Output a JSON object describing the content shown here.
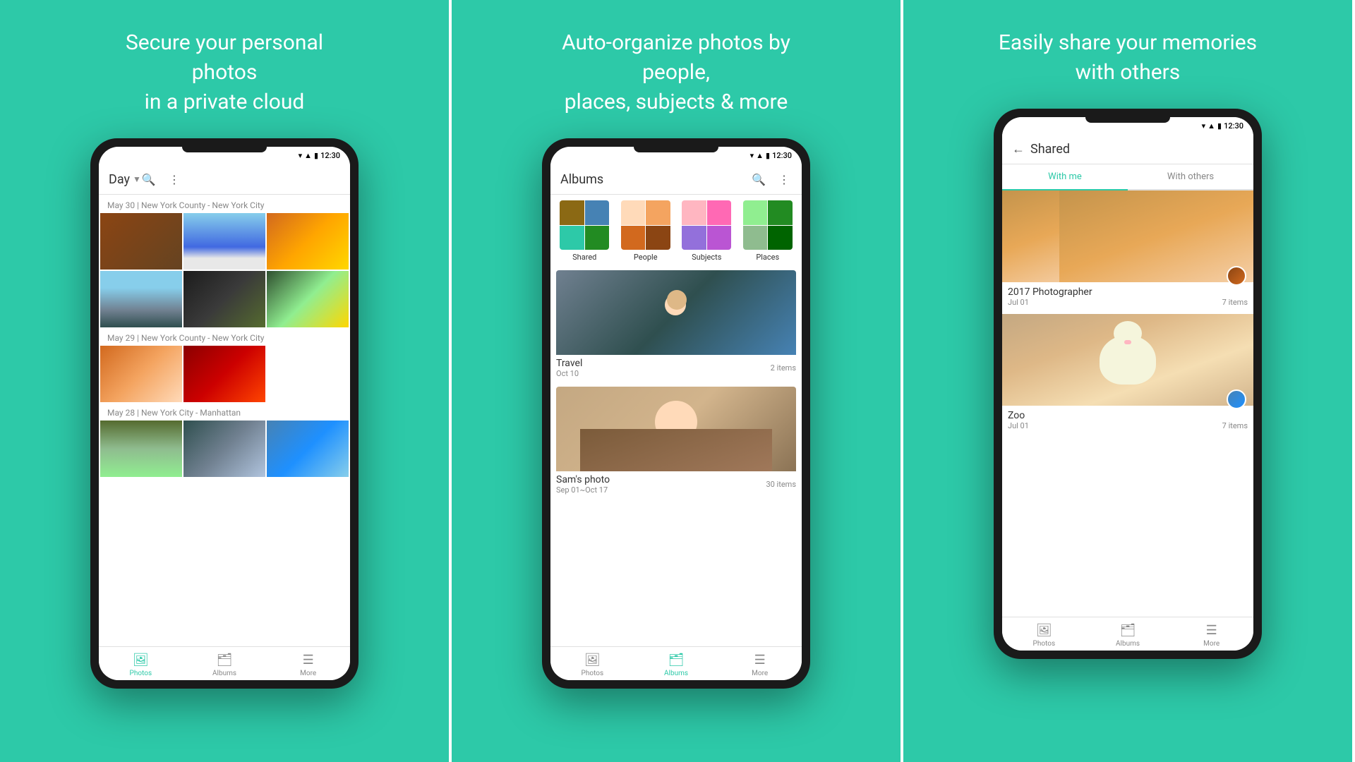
{
  "panel1": {
    "title": "Secure your personal photos\nin a private cloud",
    "toolbar": {
      "dropdown_label": "Day",
      "search_label": "search",
      "more_label": "more"
    },
    "dates": [
      {
        "label": "May 30",
        "location": "New York County - New York City"
      },
      {
        "label": "May 29",
        "location": "New York County - New York City"
      },
      {
        "label": "May 28",
        "location": "New York City - Manhattan"
      }
    ],
    "nav": {
      "photos": "Photos",
      "albums": "Albums",
      "more": "More"
    }
  },
  "panel2": {
    "title": "Auto-organize photos by people,\nplaces, subjects & more",
    "toolbar": {
      "title": "Albums"
    },
    "categories": [
      {
        "label": "Shared"
      },
      {
        "label": "People"
      },
      {
        "label": "Subjects"
      },
      {
        "label": "Places"
      }
    ],
    "albums": [
      {
        "name": "Travel",
        "date": "Oct 10",
        "count": "2 items"
      },
      {
        "name": "Sam's photo",
        "date": "Sep 01~Oct 17",
        "count": "30 items"
      }
    ],
    "nav": {
      "photos": "Photos",
      "albums": "Albums",
      "more": "More"
    }
  },
  "panel3": {
    "title": "Easily share your memories\nwith others",
    "toolbar": {
      "back_label": "back",
      "title": "Shared"
    },
    "tabs": {
      "with_me": "With me",
      "with_others": "With others"
    },
    "shared_items": [
      {
        "name": "2017 Photographer",
        "date": "Jul 01",
        "count": "7 items"
      },
      {
        "name": "Zoo",
        "date": "Jul 01",
        "count": "7 items"
      }
    ],
    "nav": {
      "photos": "Photos",
      "albums": "Albums",
      "more": "More"
    }
  },
  "colors": {
    "teal": "#2DC9A8",
    "dark_phone": "#1a1a1a",
    "white": "#ffffff",
    "text_primary": "#333333",
    "text_secondary": "#888888"
  }
}
